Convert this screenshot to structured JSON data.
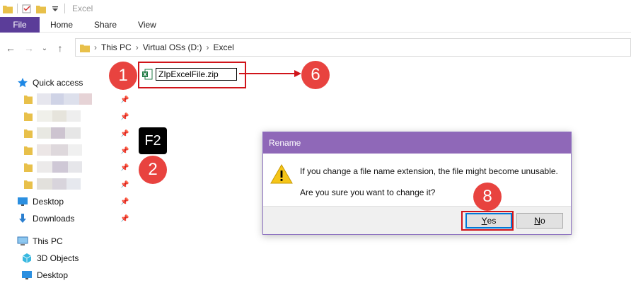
{
  "window": {
    "title": "Excel"
  },
  "ribbon": {
    "file": "File",
    "tabs": [
      "Home",
      "Share",
      "View"
    ]
  },
  "address": {
    "crumbs": [
      "This PC",
      "Virtual OSs (D:)",
      "Excel"
    ]
  },
  "navpane": {
    "quick_access": "Quick access",
    "desktop": "Desktop",
    "downloads": "Downloads",
    "this_pc": "This PC",
    "objects3d": "3D Objects",
    "desktop2": "Desktop"
  },
  "file": {
    "name": "ZIpExcelFile.zip"
  },
  "annotations": {
    "step1": "1",
    "step2": "2",
    "step6": "6",
    "step8": "8",
    "key": "F2"
  },
  "dialog": {
    "title": "Rename",
    "line1": "If you change a file name extension, the file might become unusable.",
    "line2": "Are you sure you want to change it?",
    "yes_first": "Y",
    "yes_rest": "es",
    "no_first": "N",
    "no_rest": "o"
  },
  "colors": {
    "file_tab": "#5b3d99",
    "dialog_title": "#8f68b8",
    "annotation_red": "#e8433f",
    "highlight_border": "#d0141a"
  }
}
